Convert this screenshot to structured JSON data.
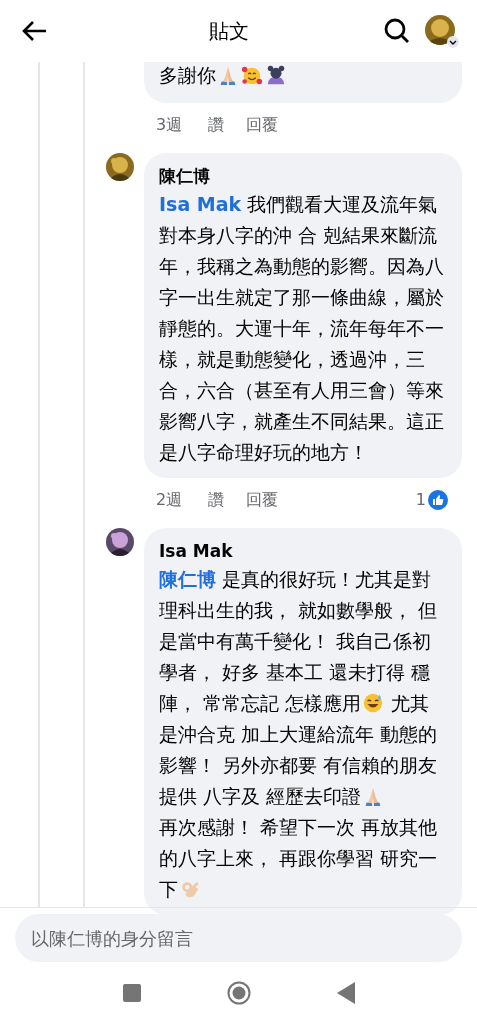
{
  "header": {
    "title": "貼文"
  },
  "comments": [
    {
      "partial": true,
      "body": [
        {
          "kind": "text",
          "text": "多謝你"
        },
        {
          "kind": "pray"
        },
        {
          "kind": "hearts"
        },
        {
          "kind": "bowing"
        }
      ],
      "time": "3週",
      "like": "讚",
      "reply": "回覆"
    },
    {
      "partial": false,
      "author": "陳仁博",
      "body": [
        {
          "kind": "mention",
          "text": "Isa Mak"
        },
        {
          "kind": "text",
          "text": " 我們觀看大運及流年氣對本身八字的沖 合 剋結果來斷流年，我稱之為動態的影嚮。因為八字一出生就定了那一條曲線，屬於靜態的。大運十年，流年每年不一樣，就是動態變化，透過沖，三合，六合（甚至有人用三會）等來影嚮八字，就產生不同結果。這正是八字命理好玩的地方！"
        }
      ],
      "time": "2週",
      "like": "讚",
      "reply": "回覆",
      "reactions": "1"
    },
    {
      "partial": false,
      "author": "Isa Mak",
      "body": [
        {
          "kind": "mention",
          "text": "陳仁博"
        },
        {
          "kind": "text",
          "text": " 是真的很好玩！尤其是對理科出生的我， 就如數學般， 但是當中有萬千變化！ 我自己係初學者， 好多 基本工 還未打得 穩陣， 常常忘記 怎樣應用"
        },
        {
          "kind": "sweat"
        },
        {
          "kind": "text",
          "text": " 尤其是沖合克 加上大運給流年 動態的影響！ 另外亦都要 有信賴的朋友提供 八字及 經歷去印證"
        },
        {
          "kind": "pray"
        },
        {
          "kind": "break"
        },
        {
          "kind": "text",
          "text": "再次感謝！ 希望下一次 再放其他的八字上來， 再跟你學習 研究一下"
        },
        {
          "kind": "ok"
        }
      ]
    }
  ],
  "composer": {
    "placeholder": "以陳仁博的身分留言"
  }
}
